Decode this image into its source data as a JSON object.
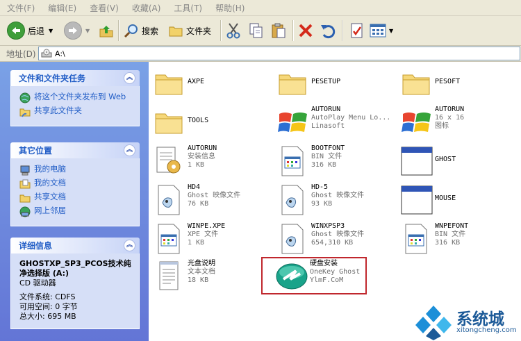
{
  "menu": [
    "文件(F)",
    "编辑(E)",
    "查看(V)",
    "收藏(A)",
    "工具(T)",
    "帮助(H)"
  ],
  "toolbar": {
    "back": "后退",
    "search": "搜索",
    "folders": "文件夹"
  },
  "address": {
    "label": "地址(D)",
    "value": "A:\\"
  },
  "tasks": {
    "title": "文件和文件夹任务",
    "items": [
      "将这个文件夹发布到 Web",
      "共享此文件夹"
    ]
  },
  "places": {
    "title": "其它位置",
    "items": [
      "我的电脑",
      "我的文档",
      "共享文档",
      "网上邻居"
    ]
  },
  "details": {
    "title": "详细信息",
    "name": "GHOSTXP_SP3_PCOS技术纯净选择版 (A:)",
    "type": "CD 驱动器",
    "fs": "文件系统: CDFS",
    "free": "可用空间: 0 字节",
    "total": "总大小: 695 MB"
  },
  "files": [
    {
      "name": "AXPE",
      "icon": "folder-icon"
    },
    {
      "name": "PESETUP",
      "icon": "folder-icon"
    },
    {
      "name": "PESOFT",
      "icon": "folder-icon"
    },
    {
      "name": "TOOLS",
      "icon": "folder-icon"
    },
    {
      "name": "AUTORUN",
      "l2": "AutoPlay Menu Lo...",
      "l3": "Linasoft",
      "icon": "windows-logo-icon"
    },
    {
      "name": "AUTORUN",
      "l2": "16 x 16",
      "l3": "图标",
      "icon": "windows-logo-icon"
    },
    {
      "name": "AUTORUN",
      "l2": "安装信息",
      "l3": "1 KB",
      "icon": "setup-info-icon"
    },
    {
      "name": "BOOTFONT",
      "l2": "BIN 文件",
      "l3": "316 KB",
      "icon": "app-file-icon"
    },
    {
      "name": "GHOST",
      "icon": "window-icon"
    },
    {
      "name": "HD4",
      "l2": "Ghost 映像文件",
      "l3": "76 KB",
      "icon": "ghost-image-icon"
    },
    {
      "name": "HD-5",
      "l2": "Ghost 映像文件",
      "l3": "93 KB",
      "icon": "ghost-image-icon"
    },
    {
      "name": "MOUSE",
      "icon": "window-icon"
    },
    {
      "name": "WINPE.XPE",
      "l2": "XPE 文件",
      "l3": "1 KB",
      "icon": "app-file-icon"
    },
    {
      "name": "WINXPSP3",
      "l2": "Ghost 映像文件",
      "l3": "654,310 KB",
      "icon": "ghost-image-icon"
    },
    {
      "name": "WNPEFONT",
      "l2": "BIN 文件",
      "l3": "316 KB",
      "icon": "app-file-icon"
    },
    {
      "name": "光盘说明",
      "l2": "文本文档",
      "l3": "18 KB",
      "icon": "text-doc-icon"
    },
    {
      "name": "硬盘安装",
      "l2": "OneKey Ghost",
      "l3": "YlmF.CoM",
      "icon": "onekey-ghost-icon"
    }
  ],
  "watermark": {
    "title": "系统城",
    "site": "xitongcheng.com"
  }
}
